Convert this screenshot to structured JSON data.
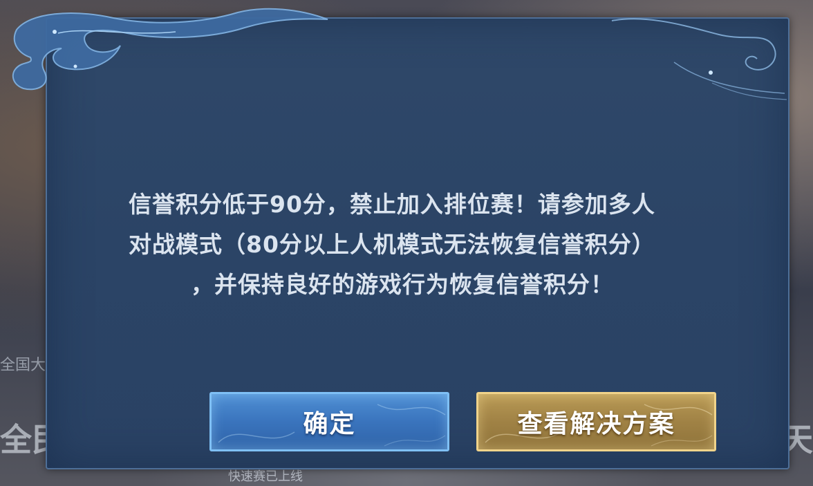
{
  "background": {
    "left_text": "全国大",
    "left_big": "全民",
    "right_big": "天",
    "bottom_text": "快速赛已上线"
  },
  "dialog": {
    "message_line1": "信誉积分低于90分，禁止加入排位赛！请参加多人",
    "message_line2": "对战模式（80分以上人机模式无法恢复信誉积分）",
    "message_line3": "，并保持良好的游戏行为恢复信誉积分！",
    "confirm_label": "确定",
    "solution_label": "查看解决方案"
  },
  "colors": {
    "dialog_bg": "#2c4567",
    "dialog_border": "#4e6f98",
    "confirm_button": "#3a74bd",
    "solution_button": "#a08245",
    "text": "#dbe4ef"
  },
  "icons": [
    "cloud-ornament-icon",
    "wave-ornament-icon"
  ]
}
